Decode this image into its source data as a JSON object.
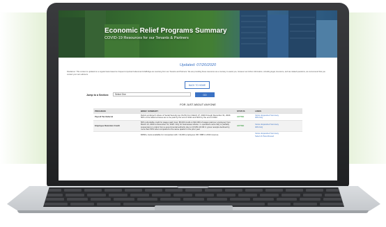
{
  "page": {
    "hero_title": "Economic Relief Programs Summary",
    "hero_subtitle": "COVID-19 Resources for our Tenants & Partners",
    "updated": "Updated: 07/20/2020",
    "disclaimer": "Disclaimer: This content is updated on a regular basis based on frequent important federal and LifeBridge are receiving from our Tenants and Partners. We are providing these resources as a courtesy to assist you, however we further information, including legal, insurance, and tax-related questions, we recommend that you contact your own advisors.",
    "back_button": "BACK TO HOME",
    "jump_label": "Jump to a Section:",
    "jump_select_value": "Select One",
    "go_button": "GO",
    "section_heading": "FOR JUST ABOUT ANYONE"
  },
  "table": {
    "headers": [
      "PROGRAM",
      "BRIEF SUMMARY",
      "STATUS",
      "LINKS"
    ],
    "rows": [
      {
        "program": "Payroll Tax Deferral",
        "summary": "Defers employer's share of Social Security tax (6.2%) from March 27, 2020 through December 31, 2020. 50% of the deferred taxes are to be paid by the end of 2021 and 50% by the end of 2022.",
        "status": "ACTIVE",
        "links": [
          "Vertex Expanded Summary",
          "IRS FAQ"
        ]
      },
      {
        "program": "Employee Retention Credit",
        "summary": "50% refundable credit for wages paid (max: $5,000 credit on $10,000 of wages paid per employee) from March 13, 2020 to December 31, 2020. Only for businesses whose: 1. operations were fully or partially suspended on orders from a governmental authority due to COVID-19 OR 2. gross receipts declined by more than 50% when compared to the same quarter in the prior year",
        "status": "ACTIVE",
        "links": [
          "Vertex Expanded Summary",
          "IRS FAQ"
        ]
      },
      {
        "program": "",
        "summary": "$350b+ loans available for companies with <10,000 employees OR <$5B in 2019 revenue.",
        "status": "",
        "links": [
          "Vertex Expanded Summary",
          "Select & Parenthesed"
        ]
      }
    ]
  },
  "colors": {
    "accent": "#3b72c4",
    "active": "#43a047",
    "hero_green": "#3f7f35"
  }
}
